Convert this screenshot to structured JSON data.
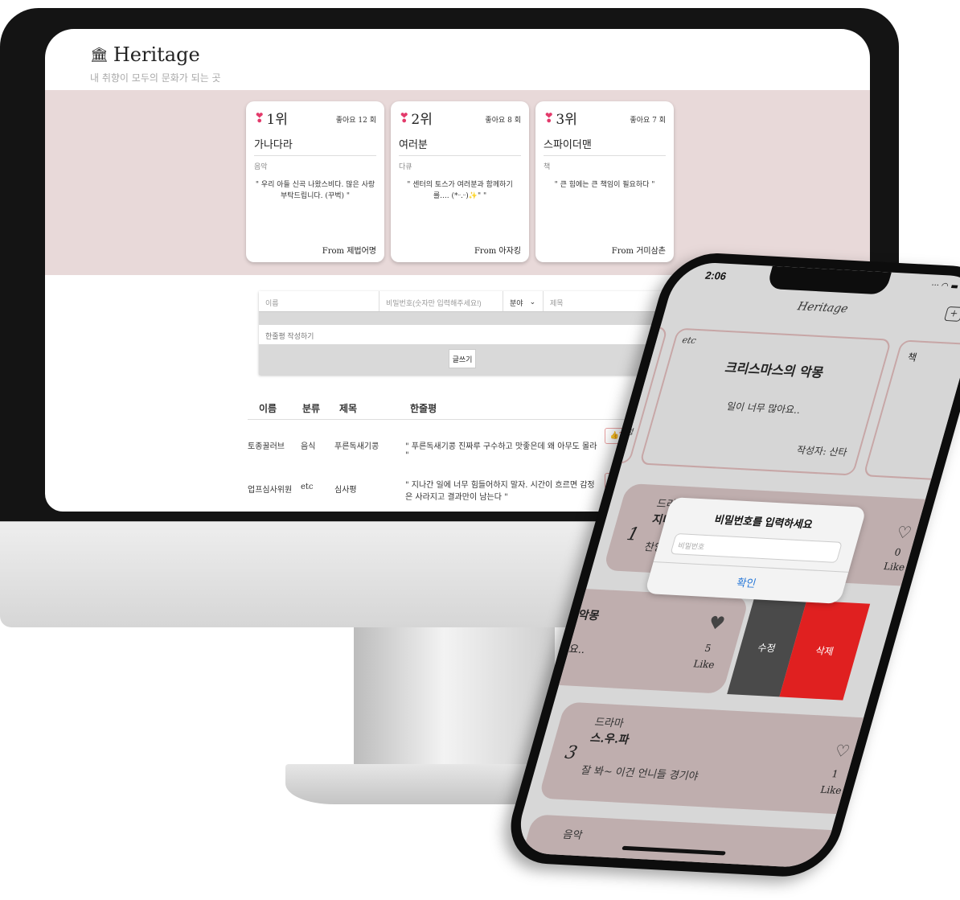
{
  "desktop": {
    "site_title": "Heritage",
    "site_subtitle": "내 취향이 모두의 문화가 되는 곳",
    "rankings": [
      {
        "rank": "1위",
        "likes": "좋아요 12 회",
        "title": "가나다라",
        "category": "음악",
        "review": "\" 우리 아들 신곡 나왔스비다. 많은 사랑 부탁드립니다. (꾸벅) \"",
        "from": "From 제법어명"
      },
      {
        "rank": "2위",
        "likes": "좋아요 8 회",
        "title": "여러분",
        "category": "다큐",
        "review": "\" 센터의 토스가 여러분과 함께하기 를.... (*ᵕ.ᵕ)✨\" \"",
        "from": "From 아자킹"
      },
      {
        "rank": "3위",
        "likes": "좋아요 7 회",
        "title": "스파이더맨",
        "category": "책",
        "review": "\" 큰 힘에는 큰 책임이 필요하다 \"",
        "from": "From 거미삼촌"
      }
    ],
    "form": {
      "name_placeholder": "이름",
      "password_placeholder": "비밀번호(숫자만 입력해주세요!)",
      "category_value": "분야",
      "title_placeholder": "제목",
      "review_placeholder": "한줄평 작성하기",
      "submit_label": "글쓰기"
    },
    "list_headers": {
      "name": "이름",
      "category": "분류",
      "title": "제목",
      "review": "한줄평"
    },
    "rows": [
      {
        "name": "토종꿀러브",
        "category": "음식",
        "title": "푸른독새기콩",
        "review": "\" 푸른독새기콩 진짜루 구수하고 맛좋은데 왜 아무도 몰라 \"",
        "likes": "2"
      },
      {
        "name": "업프심사위원",
        "category": "etc",
        "title": "심사평",
        "review": "\" 지나간 일에 너무 힘들어하지 말자. 시간이 흐르면 감정은 사라지고 결과만이 남는다 \"",
        "likes": ""
      }
    ]
  },
  "phone": {
    "time": "2:06",
    "title": "Heritage",
    "featured": {
      "category": "etc",
      "title": "크리스마스의 악몽",
      "review": "일이 너무 많아요..",
      "author": "작성자: 산타"
    },
    "side_card_label": "책",
    "side_card_left": "정",
    "row1": {
      "rank": "1",
      "category": "드라",
      "title": "지나",
      "review": "찬양",
      "count": "0",
      "like_label": "Like"
    },
    "row2": {
      "title": "악몽",
      "review": "요..",
      "count": "5",
      "like_label": "Like"
    },
    "row3": {
      "rank": "3",
      "category": "드라마",
      "title": "스.우.파",
      "review": "잘 봐~ 이건 언니들 경기야",
      "count": "1",
      "like_label": "Like"
    },
    "row4": {
      "category": "음악"
    },
    "swipe": {
      "edit_label": "수정",
      "delete_label": "삭제"
    },
    "dialog": {
      "title": "비밀번호를 입력하세요",
      "placeholder": "비밀번호",
      "confirm_label": "확인"
    }
  }
}
